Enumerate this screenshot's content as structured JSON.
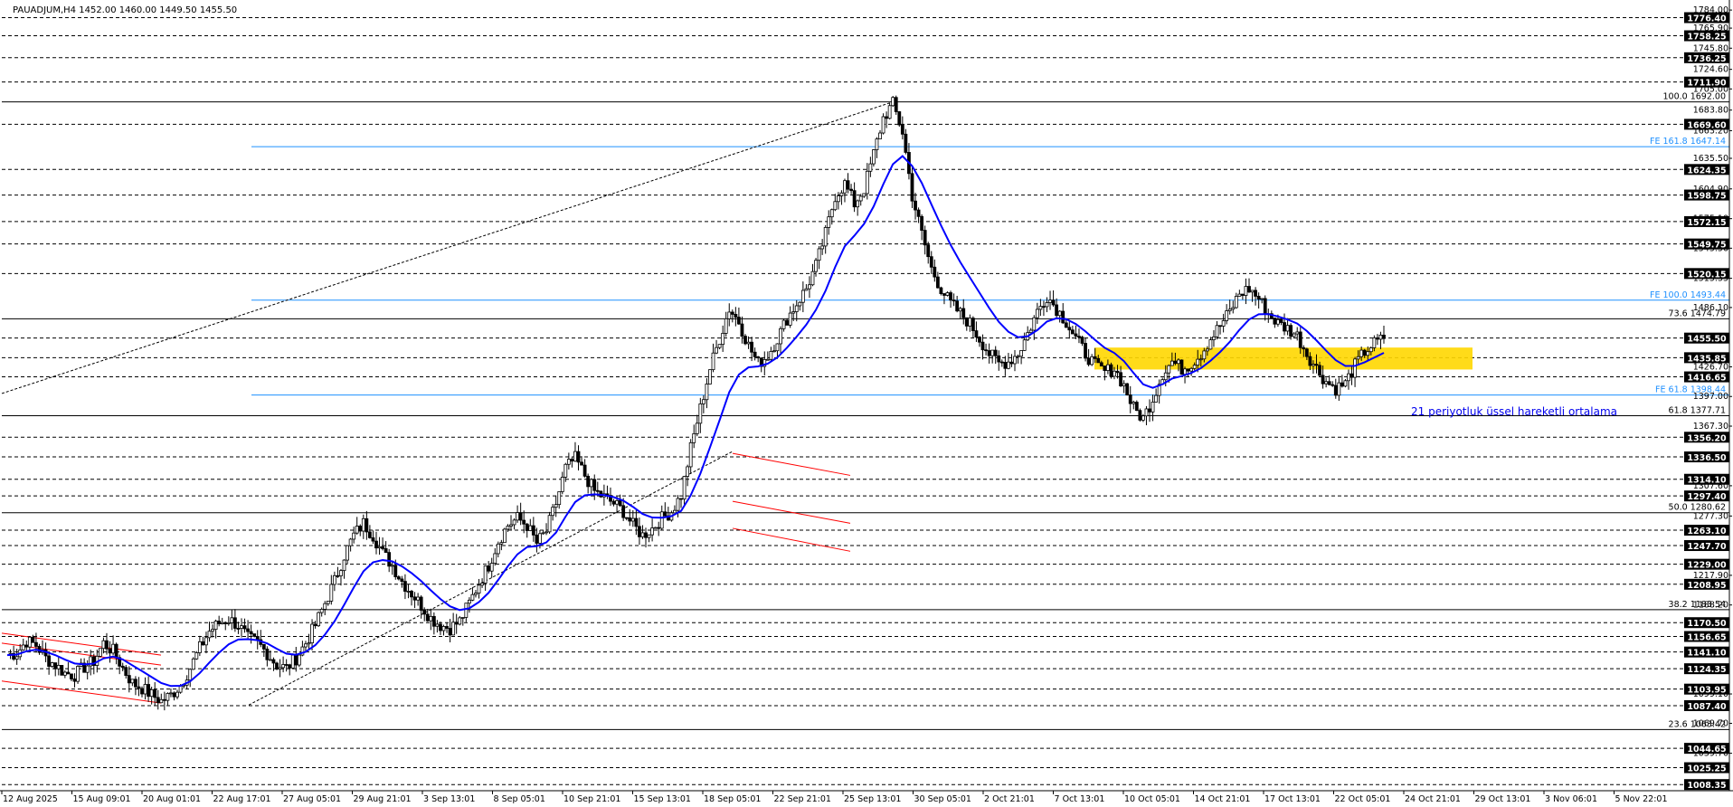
{
  "chart_data": {
    "type": "candlestick",
    "title": "PAUADJUM,H4  1452.00 1460.00 1449.50 1455.50",
    "ylim": [
      1004,
      1785
    ],
    "grid": false,
    "colors": {
      "background": "#ffffff",
      "candle": "#000000",
      "ema": "#0000ff",
      "fe_lines": "#1e90ff",
      "channel": "#ff0000",
      "zone": "#ffd700"
    },
    "y_tick_labels": [
      "1784.00",
      "1765.90",
      "1745.80",
      "1724.60",
      "1705.00",
      "1683.80",
      "1663.20",
      "1635.50",
      "1604.90",
      "1575.10",
      "1545.50",
      "1515.35",
      "1486.10",
      "1426.70",
      "1397.00",
      "1367.30",
      "1307.60",
      "1277.30",
      "1217.90",
      "1188.20",
      "1099.10",
      "1069.70",
      "1039.70"
    ],
    "dashed_levels": [
      {
        "value": 1776.4,
        "label": "1776.40"
      },
      {
        "value": 1758.25,
        "label": "1758.25"
      },
      {
        "value": 1736.25,
        "label": "1736.25"
      },
      {
        "value": 1711.9,
        "label": "1711.90"
      },
      {
        "value": 1669.6,
        "label": "1669.60"
      },
      {
        "value": 1624.35,
        "label": "1624.35"
      },
      {
        "value": 1598.75,
        "label": "1598.75"
      },
      {
        "value": 1572.15,
        "label": "1572.15"
      },
      {
        "value": 1549.75,
        "label": "1549.75"
      },
      {
        "value": 1520.15,
        "label": "1520.15"
      },
      {
        "value": 1455.5,
        "label": "1455.50"
      },
      {
        "value": 1435.85,
        "label": "1435.85"
      },
      {
        "value": 1416.65,
        "label": "1416.65"
      },
      {
        "value": 1356.2,
        "label": "1356.20"
      },
      {
        "value": 1336.5,
        "label": "1336.50"
      },
      {
        "value": 1314.1,
        "label": "1314.10"
      },
      {
        "value": 1297.4,
        "label": "1297.40"
      },
      {
        "value": 1263.1,
        "label": "1263.10"
      },
      {
        "value": 1247.7,
        "label": "1247.70"
      },
      {
        "value": 1229.0,
        "label": "1229.00"
      },
      {
        "value": 1208.95,
        "label": "1208.95"
      },
      {
        "value": 1170.5,
        "label": "1170.50"
      },
      {
        "value": 1156.65,
        "label": "1156.65"
      },
      {
        "value": 1141.1,
        "label": "1141.10"
      },
      {
        "value": 1124.35,
        "label": "1124.35"
      },
      {
        "value": 1103.95,
        "label": "1103.95"
      },
      {
        "value": 1087.4,
        "label": "1087.40"
      },
      {
        "value": 1044.65,
        "label": "1044.65"
      },
      {
        "value": 1025.25,
        "label": "1025.25"
      },
      {
        "value": 1008.35,
        "label": "1008.35"
      }
    ],
    "fib_retracement": [
      {
        "value": 1692.0,
        "label": "100.0 1692.00"
      },
      {
        "value": 1474.79,
        "label": "73.6 1474.79"
      },
      {
        "value": 1377.71,
        "label": "61.8 1377.71"
      },
      {
        "value": 1280.62,
        "label": "50.0 1280.62"
      },
      {
        "value": 1183.54,
        "label": "38.2 1183.54"
      },
      {
        "value": 1063.42,
        "label": "23.6 1063.42"
      }
    ],
    "fib_expansion": [
      {
        "value": 1647.14,
        "label": "FE 161.8 1647.14"
      },
      {
        "value": 1493.44,
        "label": "FE 100.0 1493.44"
      },
      {
        "value": 1398.44,
        "label": "FE 61.8 1398.44"
      }
    ],
    "x_labels": [
      "12 Aug 2025",
      "15 Aug 09:01",
      "20 Aug 01:01",
      "22 Aug 17:01",
      "27 Aug 05:01",
      "29 Aug 21:01",
      "3 Sep 13:01",
      "8 Sep 05:01",
      "10 Sep 21:01",
      "15 Sep 13:01",
      "18 Sep 05:01",
      "22 Sep 21:01",
      "25 Sep 13:01",
      "30 Sep 05:01",
      "2 Oct 21:01",
      "7 Oct 13:01",
      "10 Oct 05:01",
      "14 Oct 21:01",
      "17 Oct 13:01",
      "22 Oct 05:01",
      "24 Oct 21:01",
      "29 Oct 13:01",
      "3 Nov 06:01",
      "5 Nov 22:01"
    ],
    "price_path": [
      1138,
      1140,
      1152,
      1148,
      1135,
      1128,
      1120,
      1118,
      1126,
      1132,
      1150,
      1142,
      1125,
      1110,
      1105,
      1098,
      1092,
      1098,
      1108,
      1125,
      1145,
      1162,
      1170,
      1174,
      1168,
      1155,
      1150,
      1140,
      1128,
      1125,
      1135,
      1150,
      1168,
      1190,
      1212,
      1238,
      1258,
      1270,
      1258,
      1240,
      1228,
      1212,
      1200,
      1188,
      1175,
      1168,
      1165,
      1172,
      1190,
      1210,
      1228,
      1252,
      1268,
      1275,
      1268,
      1250,
      1262,
      1290,
      1325,
      1335,
      1318,
      1302,
      1296,
      1290,
      1282,
      1268,
      1258,
      1265,
      1275,
      1282,
      1298,
      1345,
      1385,
      1425,
      1455,
      1485,
      1472,
      1448,
      1430,
      1438,
      1455,
      1475,
      1490,
      1505,
      1528,
      1560,
      1598,
      1610,
      1590,
      1605,
      1640,
      1676,
      1690,
      1662,
      1598,
      1560,
      1525,
      1505,
      1490,
      1480,
      1470,
      1455,
      1440,
      1430,
      1432,
      1440,
      1460,
      1482,
      1498,
      1485,
      1472,
      1455,
      1440,
      1428,
      1422,
      1425,
      1408,
      1385,
      1375,
      1395,
      1420,
      1432,
      1425,
      1430,
      1440,
      1455,
      1468,
      1482,
      1500,
      1505,
      1495,
      1480,
      1470,
      1465,
      1458,
      1440,
      1425,
      1412,
      1405,
      1410,
      1428,
      1442,
      1450,
      1455
    ],
    "ema": {
      "name": "21 periyotluk üssel hareketli ortalama",
      "period": 21
    },
    "zone": {
      "from": 1424,
      "to": 1446
    }
  }
}
